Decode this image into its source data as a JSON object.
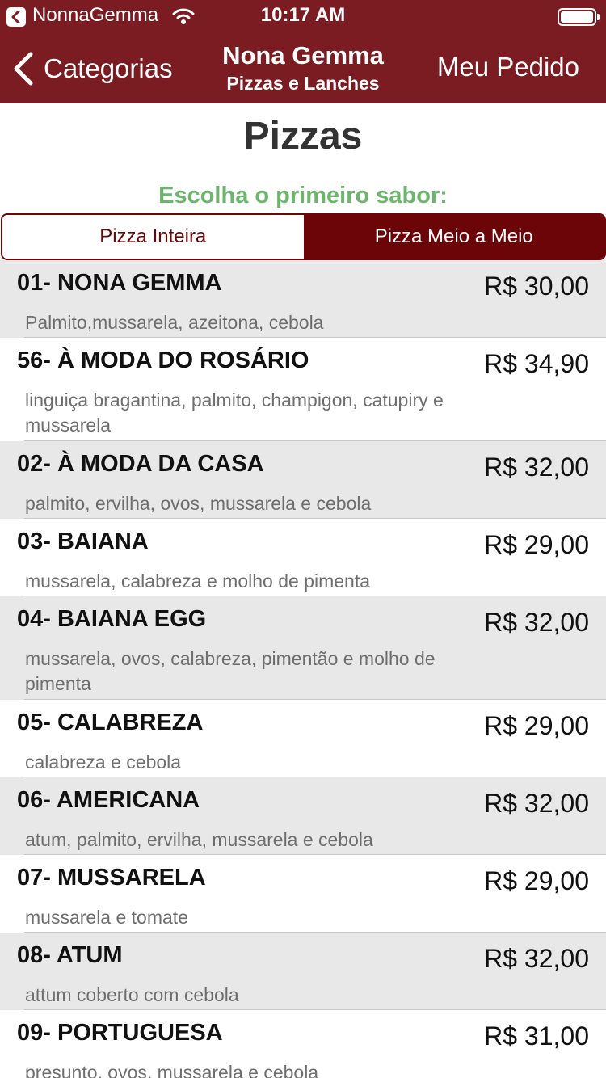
{
  "status_bar": {
    "app_name": "NonnaGemma",
    "time": "10:17 AM"
  },
  "nav": {
    "back_label": "Categorias",
    "title": "Nona Gemma",
    "subtitle": "Pizzas e Lanches",
    "right_label": "Meu Pedido"
  },
  "page": {
    "title": "Pizzas",
    "prompt": "Escolha o primeiro sabor:"
  },
  "segments": {
    "whole": "Pizza Inteira",
    "half": "Pizza Meio a Meio",
    "selected": "Pizza Meio a Meio"
  },
  "colors": {
    "nav_background": "#7b1b22",
    "accent": "#6b0508",
    "prompt": "#6db56d",
    "row_alt": "#e8e8e8"
  },
  "items": [
    {
      "name": "01- NONA GEMMA",
      "price": "R$ 30,00",
      "description": "Palmito,mussarela, azeitona, cebola"
    },
    {
      "name": "56- À MODA DO ROSÁRIO",
      "price": "R$ 34,90",
      "description": "linguiça bragantina, palmito, champigon, catupiry e mussarela"
    },
    {
      "name": "02- À MODA DA CASA",
      "price": "R$ 32,00",
      "description": "palmito, ervilha, ovos, mussarela e cebola"
    },
    {
      "name": "03- BAIANA",
      "price": "R$ 29,00",
      "description": "mussarela, calabreza e molho de pimenta"
    },
    {
      "name": "04- BAIANA EGG",
      "price": "R$ 32,00",
      "description": "mussarela, ovos, calabreza, pimentão e molho de pimenta"
    },
    {
      "name": "05- CALABREZA",
      "price": "R$ 29,00",
      "description": "calabreza e cebola"
    },
    {
      "name": "06- AMERICANA",
      "price": "R$ 32,00",
      "description": "atum, palmito, ervilha, mussarela e cebola"
    },
    {
      "name": "07- MUSSARELA",
      "price": "R$ 29,00",
      "description": "mussarela e tomate"
    },
    {
      "name": "08- ATUM",
      "price": "R$ 32,00",
      "description": "attum coberto com cebola"
    },
    {
      "name": "09- PORTUGUESA",
      "price": "R$ 31,00",
      "description": "presunto, ovos,  mussarela e cebola"
    }
  ]
}
